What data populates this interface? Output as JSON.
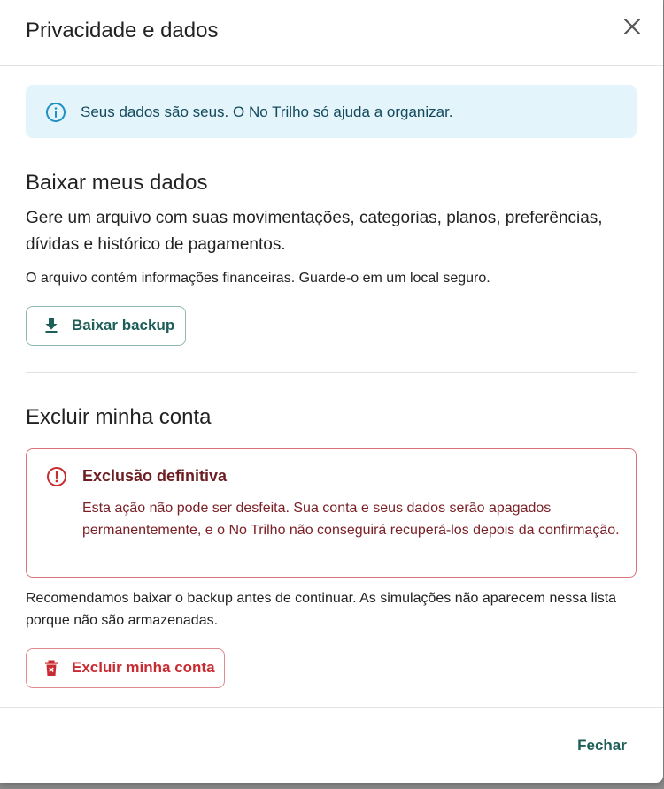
{
  "dialog": {
    "title": "Privacidade e dados",
    "close_icon": "close-icon"
  },
  "info": {
    "icon": "info-icon",
    "text": "Seus dados são seus. O No Trilho só ajuda a organizar."
  },
  "download_section": {
    "title": "Baixar meus dados",
    "description": "Gere um arquivo com suas movimentações, categorias, planos, preferências, dívidas e histórico de pagamentos.",
    "note": "O arquivo contém informações financeiras. Guarde-o em um local seguro.",
    "button_label": "Baixar backup",
    "button_icon": "download-icon"
  },
  "delete_section": {
    "title": "Excluir minha conta",
    "warning_icon": "alert-circle-icon",
    "warning_title": "Exclusão definitiva",
    "warning_text": "Esta ação não pode ser desfeita. Sua conta e seus dados serão apagados permanentemente, e o No Trilho não conseguirá recuperá-los depois da confirmação.",
    "recommendation": "Recomendamos baixar o backup antes de continuar. As simulações não aparecem nessa lista porque não são armazenadas.",
    "button_label": "Excluir minha conta",
    "button_icon": "trash-icon"
  },
  "footer": {
    "close_label": "Fechar"
  },
  "colors": {
    "accent": "#1d5e58",
    "info_bg": "#e3f4fb",
    "info_icon": "#1f8fc4",
    "danger": "#c92b32",
    "danger_border": "#d7757a",
    "danger_text": "#7a2026"
  }
}
